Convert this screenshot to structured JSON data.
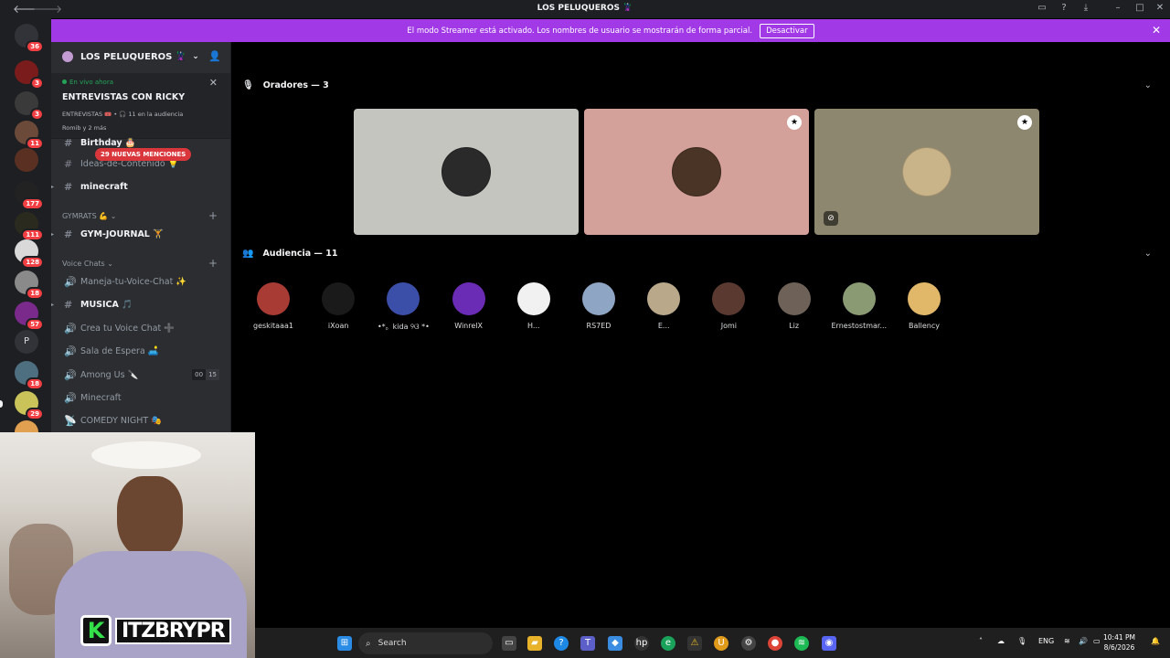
{
  "window": {
    "title": "LOS PELUQUEROS 🦹",
    "back_icon": "arrow-left-icon",
    "forward_icon": "arrow-right-icon"
  },
  "banner": {
    "text": "El modo Streamer está activado. Los nombres de usuario se mostrarán de forma parcial.",
    "button": "Desactivar"
  },
  "guilds": {
    "badges": [
      "36",
      "3",
      "3",
      "11",
      "177",
      "111",
      "128",
      "18",
      "57",
      "18",
      "29"
    ],
    "letter": "P"
  },
  "sidebar": {
    "server_name": "LOS PELUQUEROS 🦹",
    "live": {
      "label": "En vivo ahora",
      "title": "ENTREVISTAS CON RICKY",
      "meta": "ENTREVISTAS 🎟️ • 🎧 11 en la audiencia",
      "users": "Romib y 2 más"
    },
    "mentions_pill": "29 NUEVAS MENCIONES",
    "channels": [
      {
        "sym": "#",
        "label": "Birthday 🎂",
        "style": "bold"
      },
      {
        "sym": "#",
        "label": "Ideas-de-Contenido 💡",
        "style": "dim"
      },
      {
        "sym": "#",
        "label": "minecraft",
        "style": "bold"
      }
    ],
    "cat_gym": "GYMRATS 💪",
    "chan_gym": "GYM-JOURNAL 🏋️",
    "cat_voice": "Voice Chats",
    "voice_channels": [
      {
        "sym": "🔊",
        "label": "Maneja-tu-Voice-Chat ✨"
      },
      {
        "sym": "#",
        "label": "MUSICA 🎵"
      },
      {
        "sym": "🔊",
        "label": "Crea tu Voice Chat ➕"
      },
      {
        "sym": "🔊",
        "label": "Sala de Espera 🛋️"
      },
      {
        "sym": "🔊",
        "label": "Among Us 🔪"
      },
      {
        "sym": "🔊",
        "label": "Minecraft"
      },
      {
        "sym": "📡",
        "label": "COMEDY NIGHT 🎭"
      }
    ],
    "among_counts": [
      "00",
      "15"
    ]
  },
  "stage": {
    "speakers_title": "Oradores — 3",
    "audience_title": "Audiencia — 11",
    "speakers": [
      {
        "bg": "#c4c5bf",
        "avatar": "#2a2a2a",
        "star": false,
        "mute": false
      },
      {
        "bg": "#d3a09a",
        "avatar": "#4a3426",
        "star": true,
        "mute": false
      },
      {
        "bg": "#8e876f",
        "avatar": "#c9b48a",
        "star": true,
        "mute": true
      }
    ],
    "audience": [
      {
        "name": "geskitaaa1",
        "color": "#a83b34"
      },
      {
        "name": "iXoan",
        "color": "#1a1a1a"
      },
      {
        "name": "•*。kida ୨ଓ *•",
        "color": "#3b4fa8"
      },
      {
        "name": "WinrelX",
        "color": "#6a2bb5"
      },
      {
        "name": "H...",
        "color": "#f1f1f1"
      },
      {
        "name": "RS7ED",
        "color": "#8ea6c3"
      },
      {
        "name": "E...",
        "color": "#b9a88a"
      },
      {
        "name": "Jomi",
        "color": "#5a3a30"
      },
      {
        "name": "Liz",
        "color": "#6e6258"
      },
      {
        "name": "Ernestostmar...",
        "color": "#8a9a72"
      },
      {
        "name": "Ballency",
        "color": "#e1b86a"
      }
    ]
  },
  "overlay": {
    "logo_letter": "K",
    "logo_text": "ITZBRYPR"
  },
  "taskbar": {
    "search": "Search",
    "lang": "ENG",
    "time": "10:41 PM",
    "date": "8/6/2026"
  }
}
